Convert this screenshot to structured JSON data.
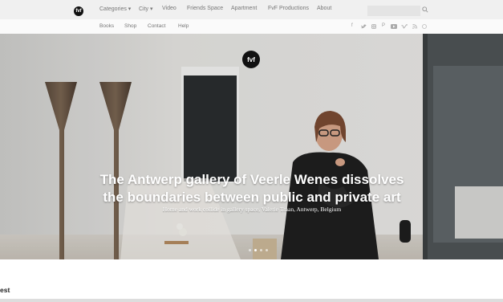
{
  "header": {
    "logo_text": "fvf",
    "nav": [
      {
        "label": "Categories ▾"
      },
      {
        "label": "City ▾"
      },
      {
        "label": "Video"
      },
      {
        "label": "Friends Space"
      },
      {
        "label": "Apartment"
      },
      {
        "label": "FvF Productions"
      },
      {
        "label": "About"
      }
    ],
    "search": {
      "placeholder": ""
    }
  },
  "subnav": {
    "items": [
      {
        "label": "Books"
      },
      {
        "label": "Shop"
      },
      {
        "label": "Contact"
      },
      {
        "label": "Help"
      }
    ],
    "social_icons": [
      "facebook-icon",
      "twitter-icon",
      "instagram-icon",
      "pinterest-icon",
      "youtube-icon",
      "vimeo-icon",
      "rss-icon",
      "globe-icon"
    ]
  },
  "hero": {
    "badge_text": "fvf",
    "title_line1": "The Antwerp gallery of Veerle Wenes dissolves",
    "title_line2": "the boundaries between public and private art",
    "subtitle": "Home and work collide in gallery space, Valerie Traan, Antwerp, Belgium",
    "slide_dots": 4,
    "active_dot": 1
  },
  "section": {
    "label": "est"
  },
  "colors": {
    "topbar": "#f0f0f0",
    "nav_text": "#777777",
    "hero_text": "#ffffff"
  }
}
